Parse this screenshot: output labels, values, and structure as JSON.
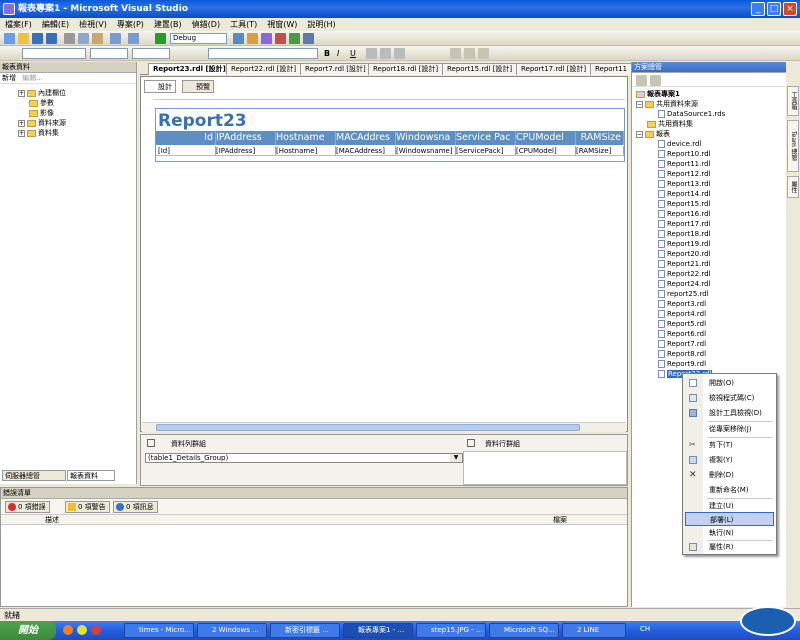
{
  "window": {
    "title": "報表專案1 - Microsoft Visual Studio"
  },
  "menubar": [
    "檔案(F)",
    "編輯(E)",
    "檢視(V)",
    "專案(P)",
    "建置(B)",
    "偵錯(D)",
    "工具(T)",
    "視窗(W)",
    "說明(H)"
  ],
  "toolbar": {
    "config": "Debug"
  },
  "left_panel": {
    "title": "報表資料",
    "new_label": "新增",
    "edit_label": "編輯...",
    "tree": [
      "內建欄位",
      "參數",
      "影像",
      "資料來源",
      "資料集"
    ],
    "bottom_tabs": [
      "伺服器總管",
      "報表資料"
    ]
  },
  "doc_tabs": [
    "Report23.rdl [設計]",
    "Report22.rdl [設計]",
    "Report7.rdl [設計]",
    "Report18.rdl [設計]",
    "Report15.rdl [設計]",
    "Report17.rdl [設計]",
    "Report11"
  ],
  "view_tabs": [
    "設計",
    "預覽"
  ],
  "report": {
    "title": "Report23",
    "columns": [
      "Id",
      "IPAddress",
      "Hostname",
      "MACAddres",
      "Windowsna",
      "Service Pac",
      "CPUModel",
      "RAMSize"
    ],
    "fields": [
      "[Id]",
      "[IPAddress]",
      "[Hostname]",
      "[MACAddress]",
      "[Windowsname]",
      "[ServicePack]",
      "[CPUModel]",
      "[RAMSize]"
    ]
  },
  "groups": {
    "row_groups_label": "資料列群組",
    "col_groups_label": "資料行群組",
    "row_group_item": "(table1_Details_Group)"
  },
  "solution": {
    "title": "方案總管",
    "root": "報表專案1",
    "shared_ds": "共用資料來源",
    "ds_file": "DataSource1.rds",
    "shared_sets": "共用資料集",
    "reports_label": "報表",
    "files": [
      "device.rdl",
      "Report10.rdl",
      "Report11.rdl",
      "Report12.rdl",
      "Report13.rdl",
      "Report14.rdl",
      "Report15.rdl",
      "Report16.rdl",
      "Report17.rdl",
      "Report18.rdl",
      "Report19.rdl",
      "Report20.rdl",
      "Report21.rdl",
      "Report22.rdl",
      "Report24.rdl",
      "report25.rdl",
      "Report3.rdl",
      "Report4.rdl",
      "Report5.rdl",
      "Report6.rdl",
      "Report7.rdl",
      "Report8.rdl",
      "Report9.rdl",
      "Report23.rdl"
    ],
    "right_tabs": [
      "工具箱",
      "Team 總管",
      "屬性"
    ]
  },
  "context_menu": {
    "items": [
      "開啟(O)",
      "檢視程式碼(C)",
      "設計工具檢視(D)",
      "從專案移除(J)",
      "剪下(T)",
      "複製(Y)",
      "刪除(D)",
      "重新命名(M)",
      "建立(U)",
      "部署(L)",
      "執行(N)",
      "屬性(R)"
    ],
    "highlighted": "部署(L)"
  },
  "error_list": {
    "title": "錯誤清單",
    "errors_btn": "0 項錯誤",
    "warnings_btn": "0 項警告",
    "messages_btn": "0 項訊息",
    "col_desc": "描述",
    "col_file": "檔案"
  },
  "status": {
    "text": "就緒"
  },
  "taskbar": {
    "start": "開始",
    "items": [
      "times - Micro...",
      "2 Windows ...",
      "新密引標籤 ...",
      "報表專案1 - ...",
      "step15.JPG - ...",
      "Microsoft SQ...",
      "2 LINE"
    ],
    "tray": "CH"
  }
}
